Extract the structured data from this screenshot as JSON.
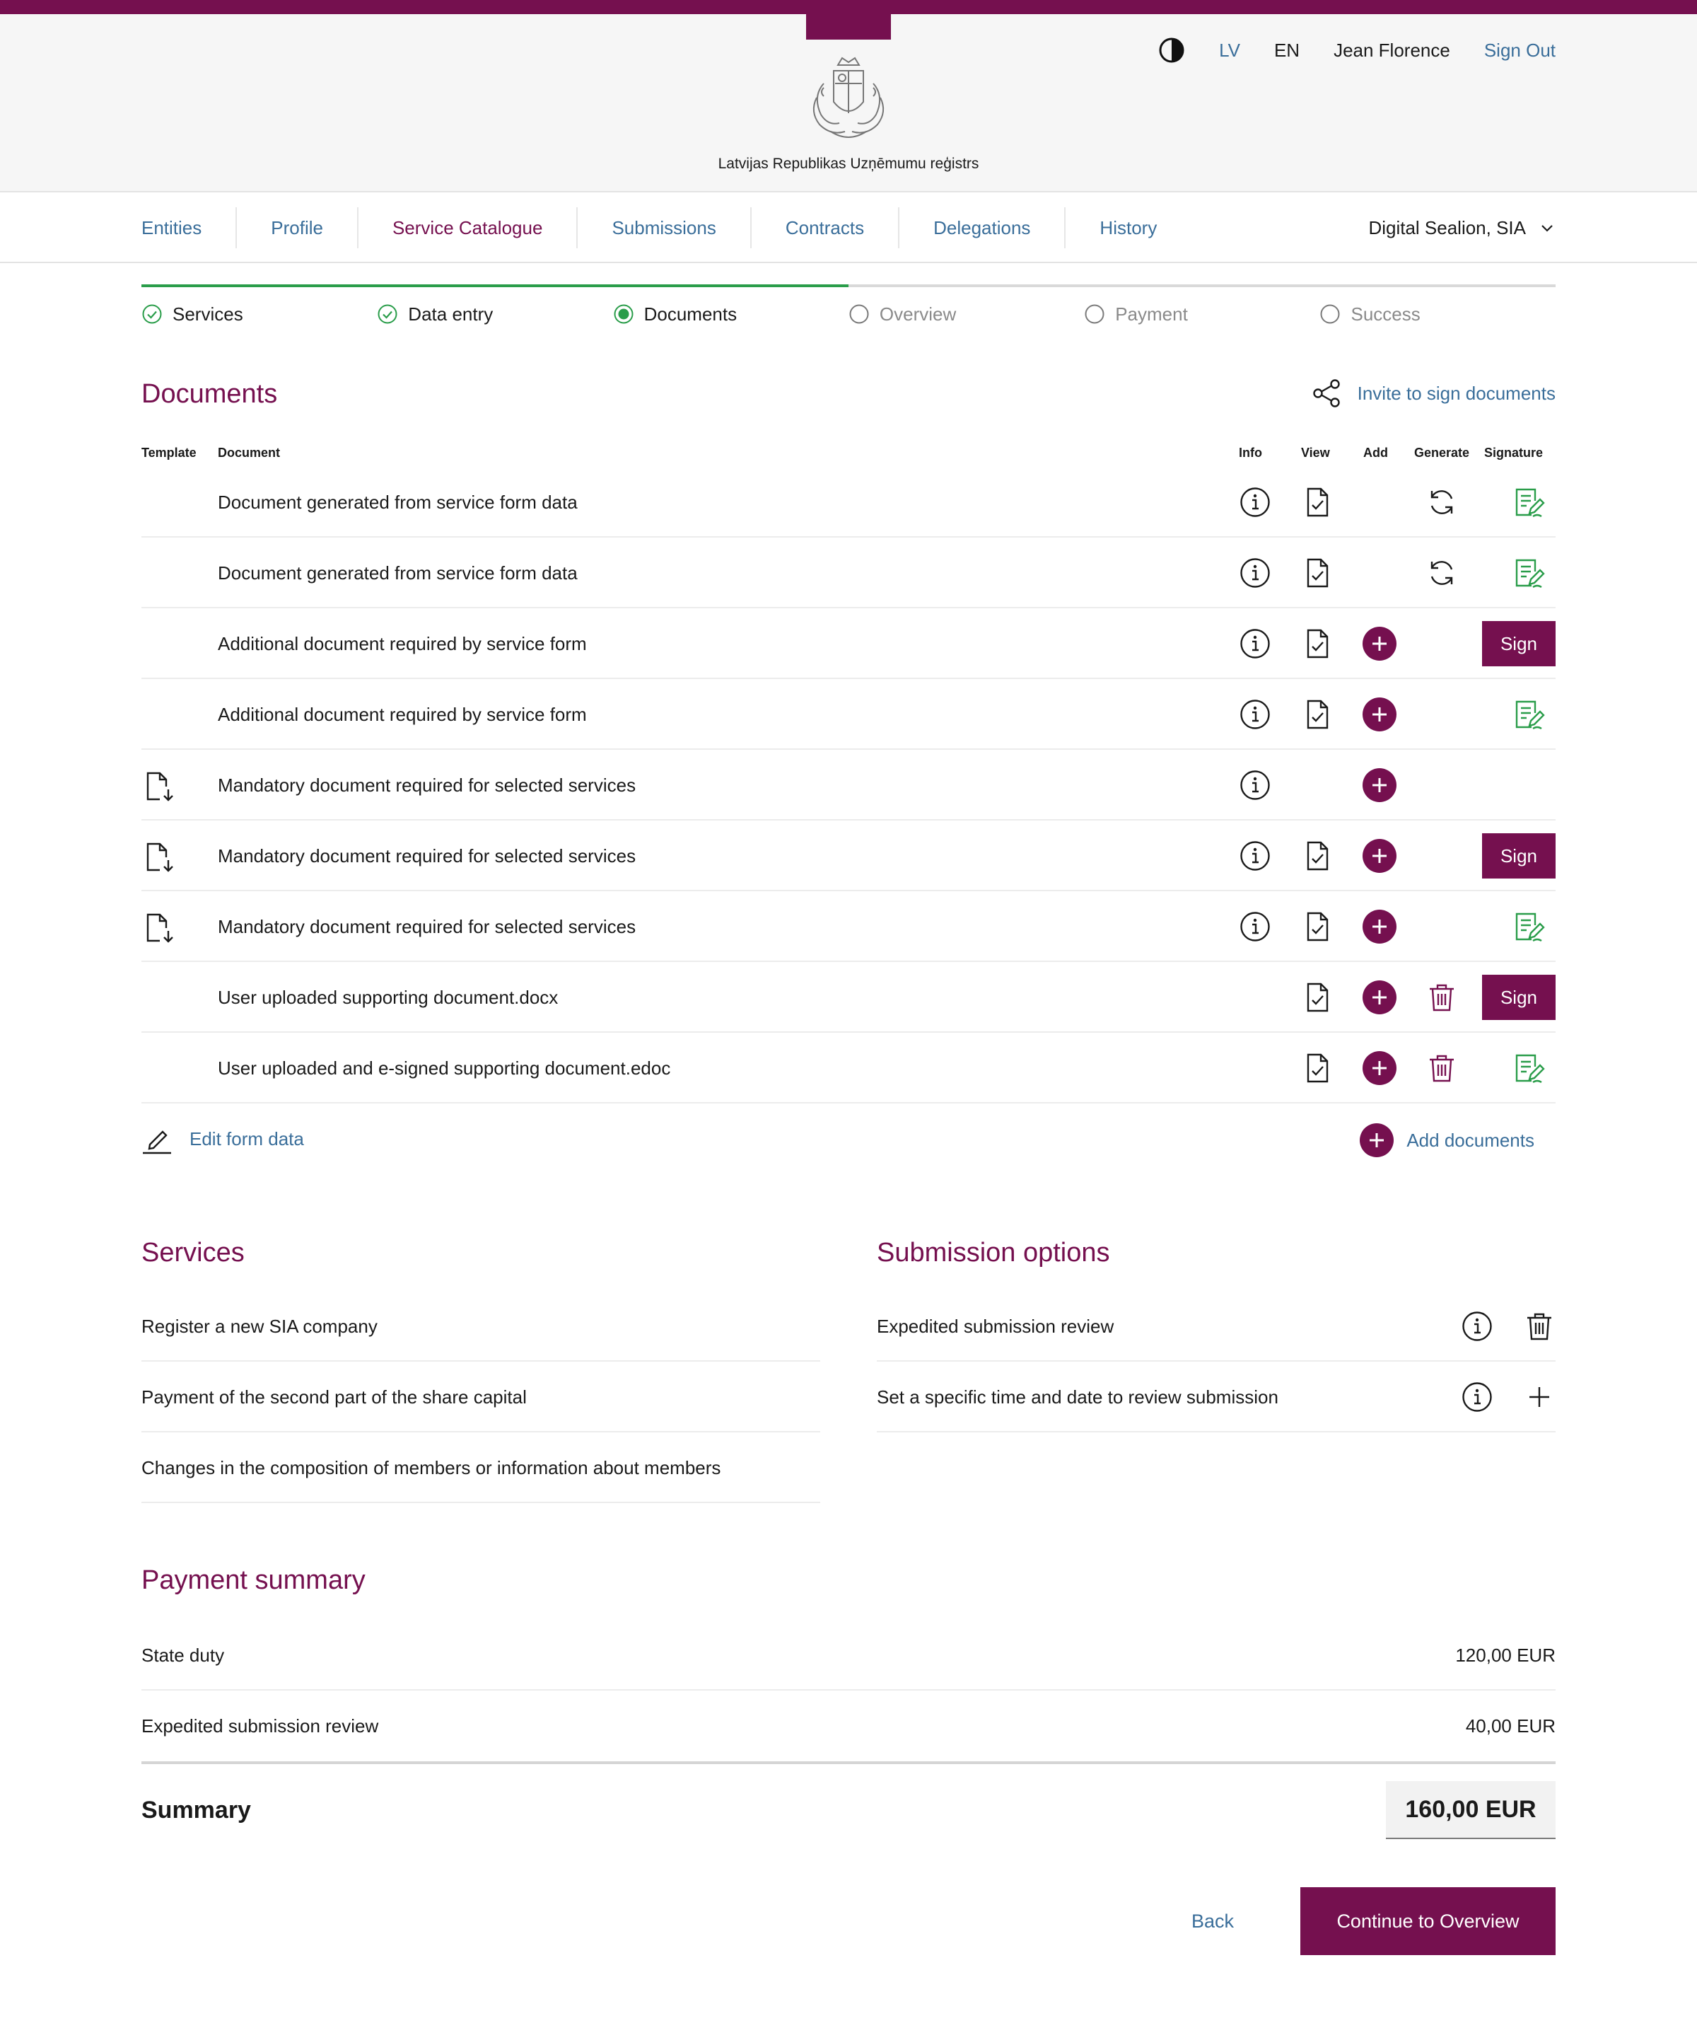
{
  "header": {
    "org_name": "Latvijas Republikas Uzņēmumu reģistrs",
    "lang_lv": "LV",
    "lang_en": "EN",
    "user": "Jean Florence",
    "sign_out": "Sign Out"
  },
  "nav": {
    "items": [
      "Entities",
      "Profile",
      "Service Catalogue",
      "Submissions",
      "Contracts",
      "Delegations",
      "History"
    ],
    "active": "Service Catalogue",
    "entity": "Digital Sealion, SIA"
  },
  "steps": [
    {
      "label": "Services",
      "state": "done"
    },
    {
      "label": "Data entry",
      "state": "done"
    },
    {
      "label": "Documents",
      "state": "current"
    },
    {
      "label": "Overview",
      "state": "pending"
    },
    {
      "label": "Payment",
      "state": "pending"
    },
    {
      "label": "Success",
      "state": "pending"
    }
  ],
  "documents": {
    "title": "Documents",
    "invite": "Invite to sign documents",
    "columns": {
      "template": "Template",
      "document": "Document",
      "info": "Info",
      "view": "View",
      "add": "Add",
      "generate": "Generate",
      "signature": "Signature"
    },
    "rows": [
      {
        "name": "Document generated from service form data",
        "template": false,
        "info": true,
        "view": true,
        "add": false,
        "generate": true,
        "delete": false,
        "signature": "signed"
      },
      {
        "name": "Document generated from service form data",
        "template": false,
        "info": true,
        "view": true,
        "add": false,
        "generate": true,
        "delete": false,
        "signature": "signed"
      },
      {
        "name": "Additional document required by service form",
        "template": false,
        "info": true,
        "view": true,
        "add": true,
        "generate": false,
        "delete": false,
        "signature": "sign"
      },
      {
        "name": "Additional document required by service form",
        "template": false,
        "info": true,
        "view": true,
        "add": true,
        "generate": false,
        "delete": false,
        "signature": "signed"
      },
      {
        "name": "Mandatory document required for selected services",
        "template": true,
        "info": true,
        "view": false,
        "add": true,
        "generate": false,
        "delete": false,
        "signature": "none"
      },
      {
        "name": "Mandatory document required for selected services",
        "template": true,
        "info": true,
        "view": true,
        "add": true,
        "generate": false,
        "delete": false,
        "signature": "sign"
      },
      {
        "name": "Mandatory document required for selected services",
        "template": true,
        "info": true,
        "view": true,
        "add": true,
        "generate": false,
        "delete": false,
        "signature": "signed"
      },
      {
        "name": "User uploaded supporting document.docx",
        "template": false,
        "info": false,
        "view": true,
        "add": true,
        "generate": false,
        "delete": true,
        "signature": "sign"
      },
      {
        "name": "User uploaded and e-signed supporting document.edoc",
        "template": false,
        "info": false,
        "view": true,
        "add": true,
        "generate": false,
        "delete": true,
        "signature": "signed"
      }
    ],
    "sign_label": "Sign",
    "edit_form": "Edit form data",
    "add_documents": "Add documents"
  },
  "services": {
    "title": "Services",
    "items": [
      "Register a new SIA company",
      "Payment of the second part of the share capital",
      "Changes in the composition of members or information about members"
    ]
  },
  "submission_options": {
    "title": "Submission options",
    "items": [
      {
        "label": "Expedited submission review",
        "action": "delete"
      },
      {
        "label": "Set a specific time and date to review submission",
        "action": "add"
      }
    ]
  },
  "payment": {
    "title": "Payment summary",
    "rows": [
      {
        "label": "State duty",
        "amount": "120,00 EUR"
      },
      {
        "label": "Expedited submission review",
        "amount": "40,00 EUR"
      }
    ],
    "summary_label": "Summary",
    "summary_amount": "160,00 EUR"
  },
  "actions": {
    "back": "Back",
    "continue": "Continue to Overview"
  },
  "colors": {
    "brand": "#75104f",
    "link": "#3a6e9a",
    "success": "#2a9d4a"
  }
}
